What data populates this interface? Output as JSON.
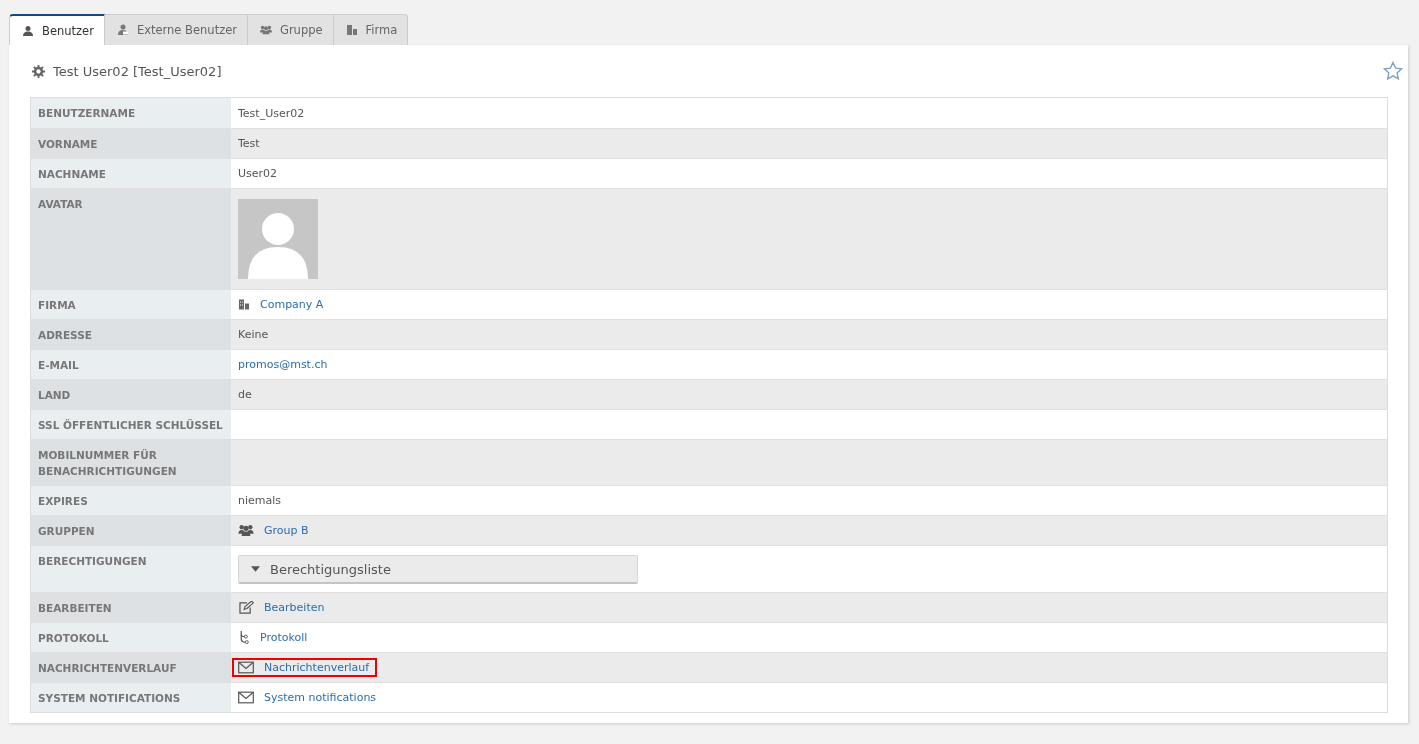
{
  "tabs": [
    {
      "label": "Benutzer",
      "selected": true
    },
    {
      "label": "Externe Benutzer",
      "selected": false
    },
    {
      "label": "Gruppe",
      "selected": false
    },
    {
      "label": "Firma",
      "selected": false
    }
  ],
  "panel": {
    "title": "Test User02 [Test_User02]",
    "favorite": false
  },
  "rows": [
    {
      "label": "BENUTZERNAME",
      "kind": "text",
      "value": "Test_User02",
      "highlighted": false
    },
    {
      "label": "VORNAME",
      "kind": "text",
      "value": "Test",
      "highlighted": false
    },
    {
      "label": "NACHNAME",
      "kind": "text",
      "value": "User02",
      "highlighted": false
    },
    {
      "label": "AVATAR",
      "kind": "avatar",
      "highlighted": false
    },
    {
      "label": "FIRMA",
      "kind": "company",
      "value": "Company A",
      "highlighted": false
    },
    {
      "label": "ADRESSE",
      "kind": "text",
      "value": "Keine",
      "highlighted": false
    },
    {
      "label": "E-MAIL",
      "kind": "link",
      "value": "promos@mst.ch",
      "highlighted": false
    },
    {
      "label": "LAND",
      "kind": "text",
      "value": "de",
      "highlighted": false
    },
    {
      "label": "SSL ÖFFENTLICHER SCHLÜSSEL",
      "kind": "empty",
      "highlighted": false
    },
    {
      "label": "MOBILNUMMER FÜR BENACHRICHTIGUNGEN",
      "kind": "empty",
      "highlighted": false
    },
    {
      "label": "EXPIRES",
      "kind": "text",
      "value": "niemals",
      "highlighted": false
    },
    {
      "label": "GRUPPEN",
      "kind": "group",
      "value": "Group B",
      "highlighted": false
    },
    {
      "label": "BERECHTIGUNGEN",
      "kind": "dropdown",
      "value": "Berechtigungsliste",
      "highlighted": false
    },
    {
      "label": "BEARBEITEN",
      "kind": "edit",
      "value": "Bearbeiten",
      "highlighted": false
    },
    {
      "label": "PROTOKOLL",
      "kind": "log",
      "value": "Protokoll",
      "highlighted": false
    },
    {
      "label": "NACHRICHTENVERLAUF",
      "kind": "messages",
      "value": "Nachrichtenverlauf",
      "highlighted": true
    },
    {
      "label": "SYSTEM NOTIFICATIONS",
      "kind": "messages",
      "value": "System notifications",
      "highlighted": false
    }
  ]
}
